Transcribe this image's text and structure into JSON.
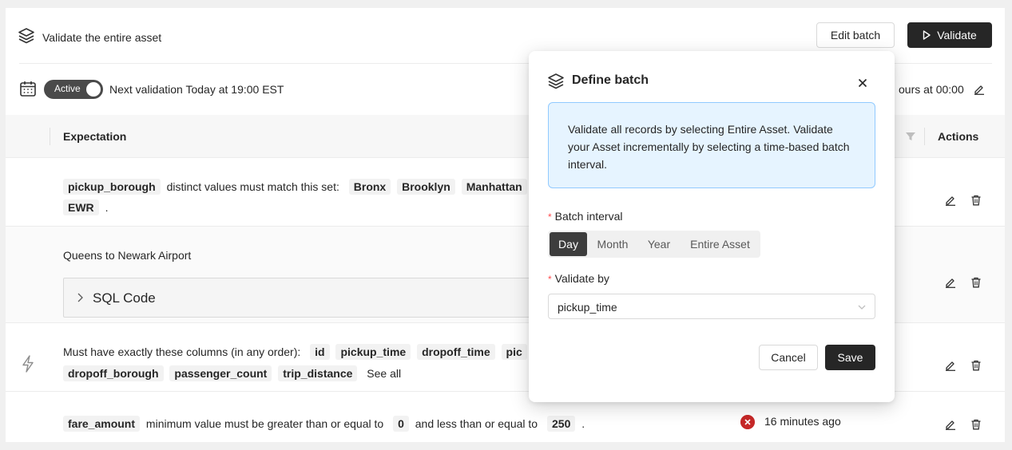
{
  "header": {
    "asset_title": "Validate the entire asset",
    "edit_batch_label": "Edit batch",
    "validate_label": "Validate"
  },
  "schedule": {
    "toggle_label": "Active",
    "toggle_on": true,
    "next_validation": "Next validation Today at 19:00 EST",
    "right_text": "ours at 00:00"
  },
  "table": {
    "col_expectation": "Expectation",
    "col_actions": "Actions"
  },
  "rows": {
    "r1": {
      "column": "pickup_borough",
      "text": "distinct values must match this set:",
      "values": [
        "Bronx",
        "Brooklyn",
        "Manhattan",
        "EWR"
      ],
      "end": "."
    },
    "r2": {
      "title": "Queens to Newark Airport",
      "sql_label": "SQL Code"
    },
    "r3": {
      "text": "Must have exactly these columns (in any order):",
      "cols1": [
        "id",
        "pickup_time",
        "dropoff_time",
        "pic"
      ],
      "cols2": [
        "dropoff_borough",
        "passenger_count",
        "trip_distance"
      ],
      "see_all": "See all"
    },
    "r4": {
      "column": "fare_amount",
      "text1": "minimum value must be greater than or equal to",
      "min": "0",
      "text2": "and less than or equal to",
      "max": "250",
      "end": ".",
      "status": "16 minutes ago",
      "status_color": "#c62828"
    }
  },
  "modal": {
    "title": "Define batch",
    "info": "Validate all records by selecting Entire Asset. Validate your Asset incrementally by selecting a time-based batch interval.",
    "batch_label": "Batch interval",
    "options": [
      "Day",
      "Month",
      "Year",
      "Entire Asset"
    ],
    "selected_option": "Day",
    "validate_by_label": "Validate by",
    "validate_by_value": "pickup_time",
    "cancel_label": "Cancel",
    "save_label": "Save"
  }
}
